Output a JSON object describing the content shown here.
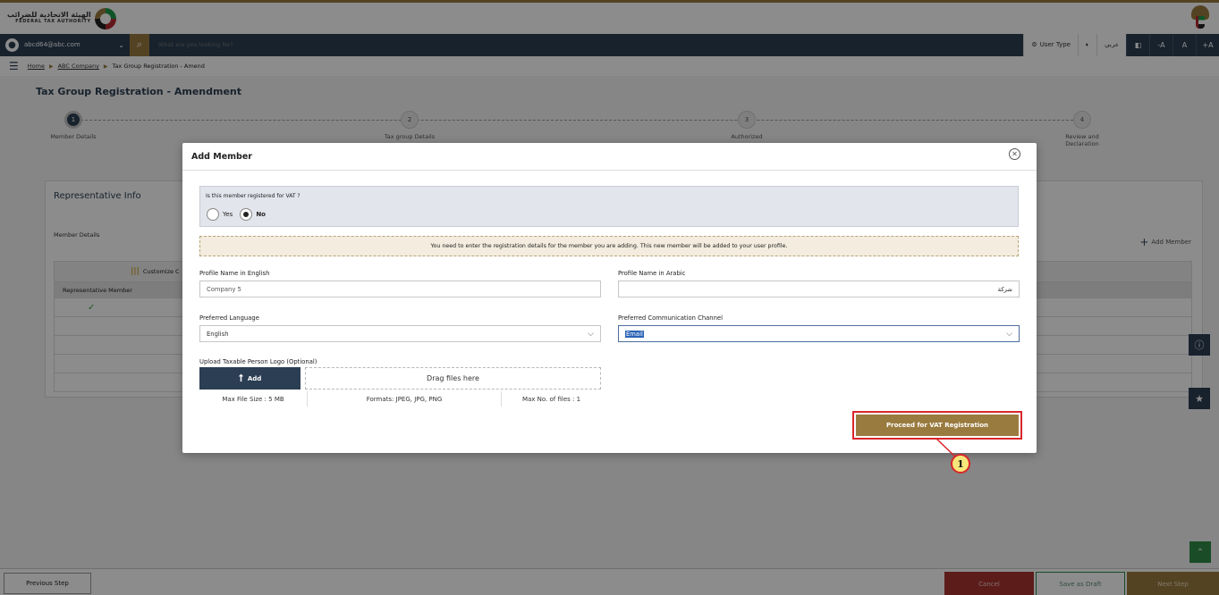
{
  "header": {
    "logo_text_ar": "الهيئة الاتحادية للضرائب",
    "logo_text_en": "FEDERAL TAX AUTHORITY"
  },
  "navbar": {
    "user_email": "abcd64@abc.com",
    "search_placeholder": "What are you looking for?",
    "user_type_label": "User Type",
    "arabic_label": "عربي",
    "font_decrease": "-A",
    "font_normal": "A",
    "font_increase": "+A"
  },
  "breadcrumb": {
    "home": "Home",
    "company": "ABC Company",
    "current": "Tax Group Registration - Amend"
  },
  "page": {
    "title": "Tax Group Registration - Amendment"
  },
  "stepper": {
    "steps": [
      {
        "number": "1",
        "label": "Member Details"
      },
      {
        "number": "2",
        "label": "Tax group Details"
      },
      {
        "number": "3",
        "label": "Authorized"
      },
      {
        "number": "4",
        "label": "Review and Declaration"
      }
    ]
  },
  "representative": {
    "title": "Representative Info",
    "member_details_label": "Member Details",
    "add_member_label": "Add Member",
    "customize_label": "Customize C",
    "column_header": "Representative Member"
  },
  "modal": {
    "title": "Add Member",
    "vat_question": "Is this member registered for VAT ?",
    "yes_label": "Yes",
    "no_label": "No",
    "vat_selected": "No",
    "notice": "You need to enter the registration details for the member you are adding. This new member will be added to your user profile.",
    "profile_en_label": "Profile Name in English",
    "profile_en_value": "Company 5",
    "profile_ar_label": "Profile Name in Arabic",
    "profile_ar_value": "شركة",
    "language_label": "Preferred Language",
    "language_value": "English",
    "channel_label": "Preferred Communication Channel",
    "channel_value": "Email",
    "upload_label": "Upload Taxable Person Logo (Optional)",
    "upload_add": "Add",
    "drop_text": "Drag files here",
    "max_size": "Max File Size : 5 MB",
    "formats": "Formats: JPEG, JPG, PNG",
    "max_files": "Max No. of files : 1",
    "proceed_button": "Proceed for VAT Registration",
    "callout_number": "1"
  },
  "footer": {
    "previous": "Previous Step",
    "cancel": "Cancel",
    "save_draft": "Save as Draft",
    "next": "Next Step"
  },
  "colors": {
    "brand_gold": "#9a7b3f",
    "navy": "#2c3e53",
    "cancel_red": "#a83330",
    "highlight_red": "#d9262b",
    "green": "#2e8b47"
  }
}
